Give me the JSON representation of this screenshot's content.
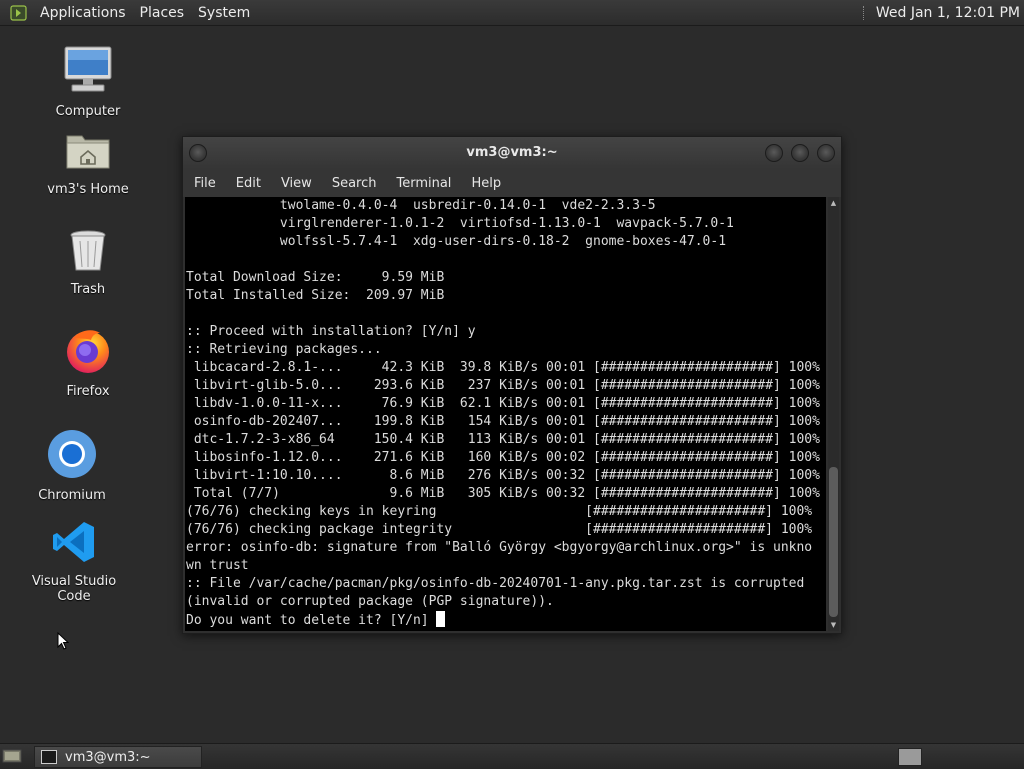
{
  "top_panel": {
    "menus": [
      "Applications",
      "Places",
      "System"
    ],
    "clock": "Wed Jan  1, 12:01 PM"
  },
  "desktop_icons": [
    {
      "label": "Computer",
      "icon": "computer-icon"
    },
    {
      "label": "vm3's Home",
      "icon": "home-folder-icon"
    },
    {
      "label": "Trash",
      "icon": "trash-icon"
    },
    {
      "label": "Firefox",
      "icon": "firefox-icon"
    },
    {
      "label": "Chromium",
      "icon": "chromium-icon"
    },
    {
      "label": "Visual Studio Code",
      "icon": "vscode-icon"
    }
  ],
  "terminal": {
    "title": "vm3@vm3:~",
    "menus": [
      "File",
      "Edit",
      "View",
      "Search",
      "Terminal",
      "Help"
    ],
    "lines": [
      "            twolame-0.4.0-4  usbredir-0.14.0-1  vde2-2.3.3-5",
      "            virglrenderer-1.0.1-2  virtiofsd-1.13.0-1  wavpack-5.7.0-1",
      "            wolfssl-5.7.4-1  xdg-user-dirs-0.18-2  gnome-boxes-47.0-1",
      "",
      "Total Download Size:     9.59 MiB",
      "Total Installed Size:  209.97 MiB",
      "",
      ":: Proceed with installation? [Y/n] y",
      ":: Retrieving packages...",
      " libcacard-2.8.1-...     42.3 KiB  39.8 KiB/s 00:01 [######################] 100%",
      " libvirt-glib-5.0...    293.6 KiB   237 KiB/s 00:01 [######################] 100%",
      " libdv-1.0.0-11-x...     76.9 KiB  62.1 KiB/s 00:01 [######################] 100%",
      " osinfo-db-202407...    199.8 KiB   154 KiB/s 00:01 [######################] 100%",
      " dtc-1.7.2-3-x86_64     150.4 KiB   113 KiB/s 00:01 [######################] 100%",
      " libosinfo-1.12.0...    271.6 KiB   160 KiB/s 00:02 [######################] 100%",
      " libvirt-1:10.10....      8.6 MiB   276 KiB/s 00:32 [######################] 100%",
      " Total (7/7)              9.6 MiB   305 KiB/s 00:32 [######################] 100%",
      "(76/76) checking keys in keyring                   [######################] 100%",
      "(76/76) checking package integrity                 [######################] 100%",
      "error: osinfo-db: signature from \"Balló György <bgyorgy@archlinux.org>\" is unkno",
      "wn trust",
      ":: File /var/cache/pacman/pkg/osinfo-db-20240701-1-any.pkg.tar.zst is corrupted",
      "(invalid or corrupted package (PGP signature)).",
      "Do you want to delete it? [Y/n] "
    ]
  },
  "taskbar": {
    "task_label": "vm3@vm3:~"
  }
}
